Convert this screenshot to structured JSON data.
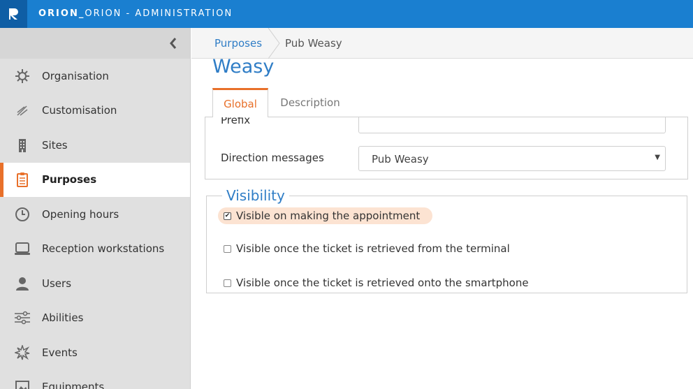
{
  "header": {
    "logo_letter": "R",
    "title_bold": "ORION_",
    "title_rest": "ORION - ADMINISTRATION"
  },
  "sidebar": {
    "collapse_icon": "chevron-left-icon",
    "items": [
      {
        "label": "Organisation",
        "icon": "network-icon",
        "active": false
      },
      {
        "label": "Customisation",
        "icon": "brush-icon",
        "active": false
      },
      {
        "label": "Sites",
        "icon": "building-icon",
        "active": false
      },
      {
        "label": "Purposes",
        "icon": "clipboard-icon",
        "active": true
      },
      {
        "label": "Opening hours",
        "icon": "clock-icon",
        "active": false
      },
      {
        "label": "Reception workstations",
        "icon": "laptop-icon",
        "active": false
      },
      {
        "label": "Users",
        "icon": "user-icon",
        "active": false
      },
      {
        "label": "Abilities",
        "icon": "sliders-icon",
        "active": false
      },
      {
        "label": "Events",
        "icon": "burst-icon",
        "active": false
      },
      {
        "label": "Equipments",
        "icon": "image-icon",
        "active": false
      }
    ]
  },
  "breadcrumb": {
    "parent": "Purposes",
    "current": "Pub Weasy"
  },
  "page": {
    "title": "Weasy"
  },
  "tabs": [
    {
      "label": "Global",
      "active": true
    },
    {
      "label": "Description",
      "active": false
    }
  ],
  "form": {
    "prefix_label": "Prefix",
    "prefix_value": "",
    "direction_label": "Direction messages",
    "direction_value": "Pub Weasy"
  },
  "visibility": {
    "legend": "Visibility",
    "options": [
      {
        "label": "Visible on making the appointment",
        "checked": true
      },
      {
        "label": "Visible once the ticket is retrieved from the terminal",
        "checked": false
      },
      {
        "label": "Visible once the ticket is retrieved onto the smartphone",
        "checked": false
      }
    ]
  },
  "colors": {
    "header_blue": "#1a7fd0",
    "accent_orange": "#e8702a",
    "link_blue": "#2f7dc6",
    "highlight": "#fce3d2"
  }
}
